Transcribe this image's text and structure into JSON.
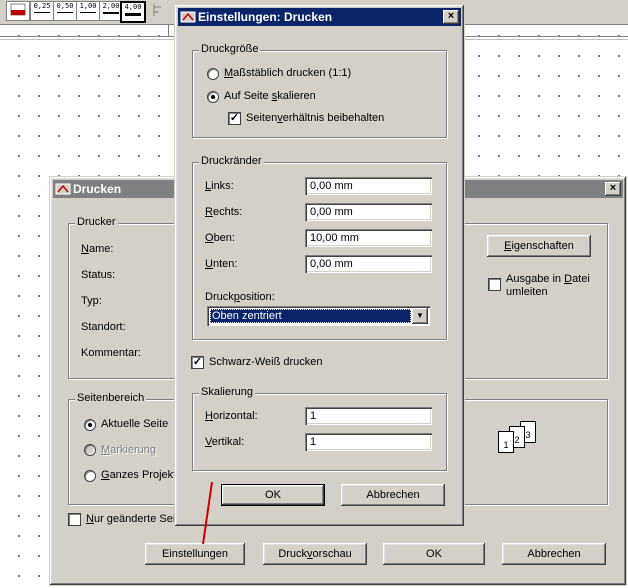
{
  "toolbar": {
    "line_widths": [
      "0,25",
      "0,50",
      "1,00",
      "2,00",
      "4,00"
    ],
    "selected": "4,00"
  },
  "drucken": {
    "title": "Drucken",
    "close": "×",
    "drucker_group": "Drucker",
    "name_label": "Name:",
    "status_label": "Status:",
    "typ_label": "Typ:",
    "standort_label": "Standort:",
    "kommentar_label": "Kommentar:",
    "eigenschaften": "Eigenschaften",
    "ausgabe_in_datei": "Ausgabe in Datei",
    "umleiten": "umleiten",
    "seitenbereich_group": "Seitenbereich",
    "aktuelle_seite": "Aktuelle Seite",
    "markierung": "Markierung",
    "ganzes_projekt": "Ganzes Projekt",
    "nur_geaenderte": "Nur geänderte Sei",
    "collate_pages": [
      "1",
      "2",
      "3"
    ],
    "buttons": {
      "einstellungen": "Einstellungen",
      "druckvorschau": "Druckvorschau",
      "ok": "OK",
      "abbrechen": "Abbrechen"
    }
  },
  "einstellungen": {
    "title": "Einstellungen: Drucken",
    "close": "×",
    "druckgroesse_group": "Druckgröße",
    "massstaeblich": "Maßstäblich drucken (1:1)",
    "auf_seite": "Auf Seite skalieren",
    "seitenverhaeltnis": "Seitenverhältnis beibehalten",
    "druckraender_group": "Druckränder",
    "links_label": "Links:",
    "links_value": "0,00 mm",
    "rechts_label": "Rechts:",
    "rechts_value": "0,00 mm",
    "oben_label": "Oben:",
    "oben_value": "10,00 mm",
    "unten_label": "Unten:",
    "unten_value": "0,00 mm",
    "druckposition_label": "Druckposition:",
    "druckposition_value": "Oben zentriert",
    "schwarz_weiss": "Schwarz-Weiß drucken",
    "skalierung_group": "Skalierung",
    "horizontal_label": "Horizontal:",
    "horizontal_value": "1",
    "vertikal_label": "Vertikal:",
    "vertikal_value": "1",
    "ok": "OK",
    "abbrechen": "Abbrechen"
  },
  "state": {
    "massstaeblich_checked": false,
    "auf_seite_checked": true,
    "seitenverhaeltnis_checked": true,
    "schwarz_weiss_checked": true,
    "aktuelle_seite_checked": true,
    "ausgabe_checked": false,
    "nur_geaenderte_checked": false
  },
  "colors": {
    "active_title": "#0a246a",
    "inactive_title": "#808080",
    "dialog_face": "#d4d0c8",
    "annotation_line": "#d00000"
  }
}
